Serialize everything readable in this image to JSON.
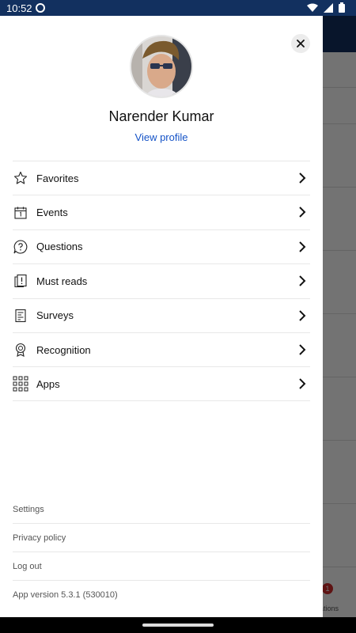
{
  "status_bar": {
    "time": "10:52",
    "icons": [
      "notification-icon",
      "wifi-icon",
      "cellular-icon",
      "battery-icon"
    ]
  },
  "background_app": {
    "badge_count": "1",
    "tab_label_fragment": "ations"
  },
  "drawer": {
    "close_icon": "close-icon",
    "user": {
      "name": "Narender Kumar",
      "view_profile_label": "View profile"
    },
    "menu": [
      {
        "label": "Favorites",
        "icon": "star-icon"
      },
      {
        "label": "Events",
        "icon": "calendar-icon"
      },
      {
        "label": "Questions",
        "icon": "question-bubble-icon"
      },
      {
        "label": "Must reads",
        "icon": "must-read-icon"
      },
      {
        "label": "Surveys",
        "icon": "survey-icon"
      },
      {
        "label": "Recognition",
        "icon": "award-icon"
      },
      {
        "label": "Apps",
        "icon": "apps-grid-icon"
      }
    ],
    "footer": {
      "settings": "Settings",
      "privacy_policy": "Privacy policy",
      "log_out": "Log out",
      "app_version": "App version 5.3.1 (530010)"
    }
  },
  "colors": {
    "header": "#12305f",
    "link": "#1553c7",
    "badge": "#d12b2b"
  }
}
